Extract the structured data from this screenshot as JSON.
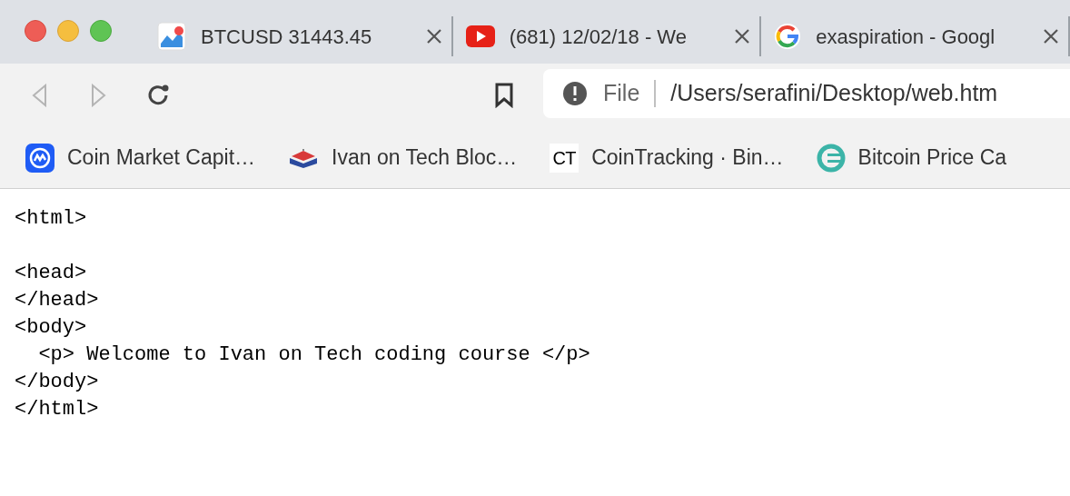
{
  "tabs": [
    {
      "kind": "chart",
      "title": "BTCUSD 31443.45",
      "selected": false
    },
    {
      "kind": "video",
      "title": "(681) 12/02/18 - We",
      "selected": false
    },
    {
      "kind": "google",
      "title": "exaspiration - Googl",
      "selected": false
    }
  ],
  "address_bar": {
    "scheme": "File",
    "url": "/Users/serafini/Desktop/web.htm"
  },
  "bookmarks": [
    {
      "kind": "coin",
      "title": "Coin Market Capit…"
    },
    {
      "kind": "book",
      "title": "Ivan on Tech Bloc…"
    },
    {
      "kind": "ct",
      "title": "CoinTracking · Bin…",
      "icon_text": "CT"
    },
    {
      "kind": "ring",
      "title": "Bitcoin Price Ca"
    }
  ],
  "page_source_blocks": [
    [
      "<html>"
    ],
    [
      "<head>",
      "</head>",
      "<body>",
      "  <p> Welcome to Ivan on Tech coding course </p>",
      "</body>",
      "</html>"
    ]
  ]
}
